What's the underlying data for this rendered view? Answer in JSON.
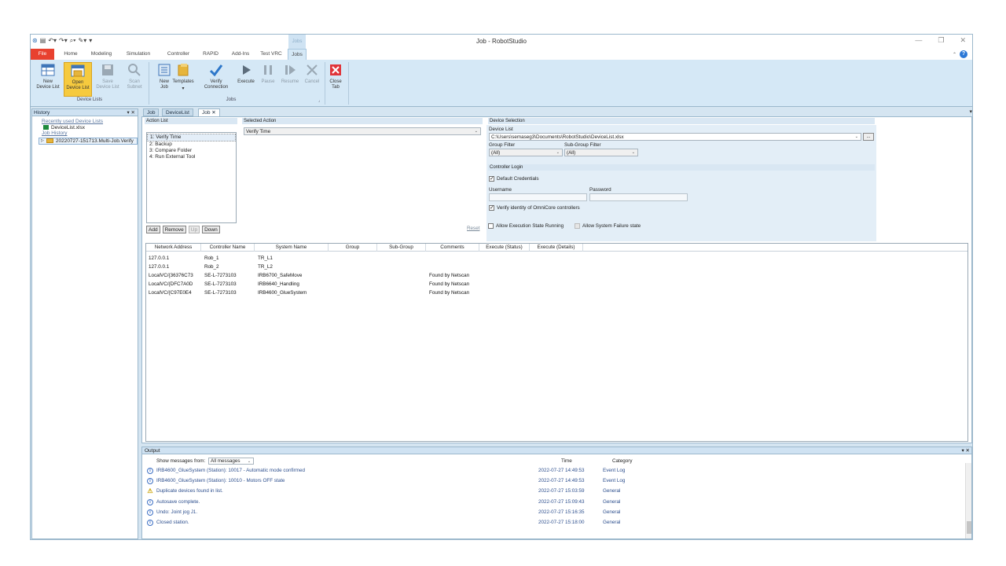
{
  "window": {
    "title": "Job - RobotStudio",
    "context_tab_header": "Jobs"
  },
  "ribbon_tabs": [
    "File",
    "Home",
    "Modeling",
    "Simulation",
    "Controller",
    "RAPID",
    "Add-Ins",
    "Test VRC",
    "Jobs"
  ],
  "ribbon": {
    "device_lists_group": "Device Lists",
    "jobs_group": "Jobs",
    "new_device_list": "New\nDevice List",
    "open_device_list": "Open\nDevice List",
    "save_device_list": "Save\nDevice List",
    "scan_subnet": "Scan\nSubnet",
    "new_job": "New\nJob",
    "templates": "Templates",
    "verify_connection": "Verify\nConnection",
    "execute": "Execute",
    "pause": "Pause",
    "resume": "Resume",
    "cancel": "Cancel",
    "close_tab": "Close\nTab"
  },
  "history": {
    "title": "History",
    "recent_link": "Recently used Device Lists",
    "recent_file": "DeviceList.xlsx",
    "job_history_link": "Job History",
    "job_item": "20220727-151713.Multi-Job.Verify"
  },
  "doc_tabs": [
    "Job",
    "DeviceList",
    "Job ✕"
  ],
  "job": {
    "action_list_header": "Action List",
    "actions": [
      "1: Verify Time",
      "2: Backup",
      "3: Compare Folder",
      "4: Run External Tool"
    ],
    "btn_add": "Add",
    "btn_remove": "Remove",
    "btn_up": "Up",
    "btn_down": "Down",
    "selected_action_header": "Selected Action",
    "selected_action_value": "Verify Time",
    "reset": "Reset",
    "device_selection_header": "Device Selection",
    "device_list_label": "Device List",
    "device_list_value": "C:\\Users\\semaseg3\\Documents\\RobotStudio\\DeviceList.xlsx",
    "group_filter_label": "Group Filter",
    "group_filter_value": "(All)",
    "subgroup_filter_label": "Sub-Group Filter",
    "subgroup_filter_value": "(All)",
    "controller_login_header": "Controller Login",
    "default_credentials": "Default Credentials",
    "username_label": "Username",
    "password_label": "Password",
    "verify_identity": "Verify identity of OmniCore controllers",
    "allow_execution_running": "Allow Execution State Running",
    "allow_system_failure": "Allow System Failure state"
  },
  "device_table": {
    "columns": [
      "Network Address",
      "Controller Name",
      "System Name",
      "Group",
      "Sub-Group",
      "Comments",
      "Execute (Status)",
      "Execute (Details)"
    ],
    "rows": [
      [
        "127.0.0.1",
        "Rob_1",
        "TR_L1",
        "",
        "",
        "",
        "",
        ""
      ],
      [
        "127.0.0.1",
        "Rob_2",
        "TR_L2",
        "",
        "",
        "",
        "",
        ""
      ],
      [
        "LocalVC/{36376C73",
        "SE-L-7273103",
        "IRB6700_SafeMove",
        "",
        "",
        "Found by Netscan",
        "",
        ""
      ],
      [
        "LocalVC/{DFC7A0D",
        "SE-L-7273103",
        "IRB6640_Handling",
        "",
        "",
        "Found by Netscan",
        "",
        ""
      ],
      [
        "LocalVC/{C97E0E4",
        "SE-L-7273103",
        "IRB4600_GlueSystem",
        "",
        "",
        "Found by Netscan",
        "",
        ""
      ]
    ]
  },
  "output": {
    "title": "Output",
    "filter_label": "Show messages from:",
    "filter_value": "All messages",
    "col_time": "Time",
    "col_category": "Category",
    "rows": [
      {
        "icon": "info",
        "msg": "IRB4600_GlueSystem (Station): 10017 - Automatic mode confirmed",
        "time": "2022-07-27 14:49:53",
        "cat": "Event Log"
      },
      {
        "icon": "info",
        "msg": "IRB4600_GlueSystem (Station): 10010 - Motors OFF state",
        "time": "2022-07-27 14:49:53",
        "cat": "Event Log"
      },
      {
        "icon": "warning",
        "msg": "Duplicate devices found in list.",
        "time": "2022-07-27 15:03:59",
        "cat": "General"
      },
      {
        "icon": "info",
        "msg": "Autosave complete.",
        "time": "2022-07-27 15:09:43",
        "cat": "General"
      },
      {
        "icon": "info",
        "msg": "Undo: Joint jog J1.",
        "time": "2022-07-27 15:16:35",
        "cat": "General"
      },
      {
        "icon": "info",
        "msg": "Closed station.",
        "time": "2022-07-27 15:18:00",
        "cat": "General"
      }
    ]
  }
}
